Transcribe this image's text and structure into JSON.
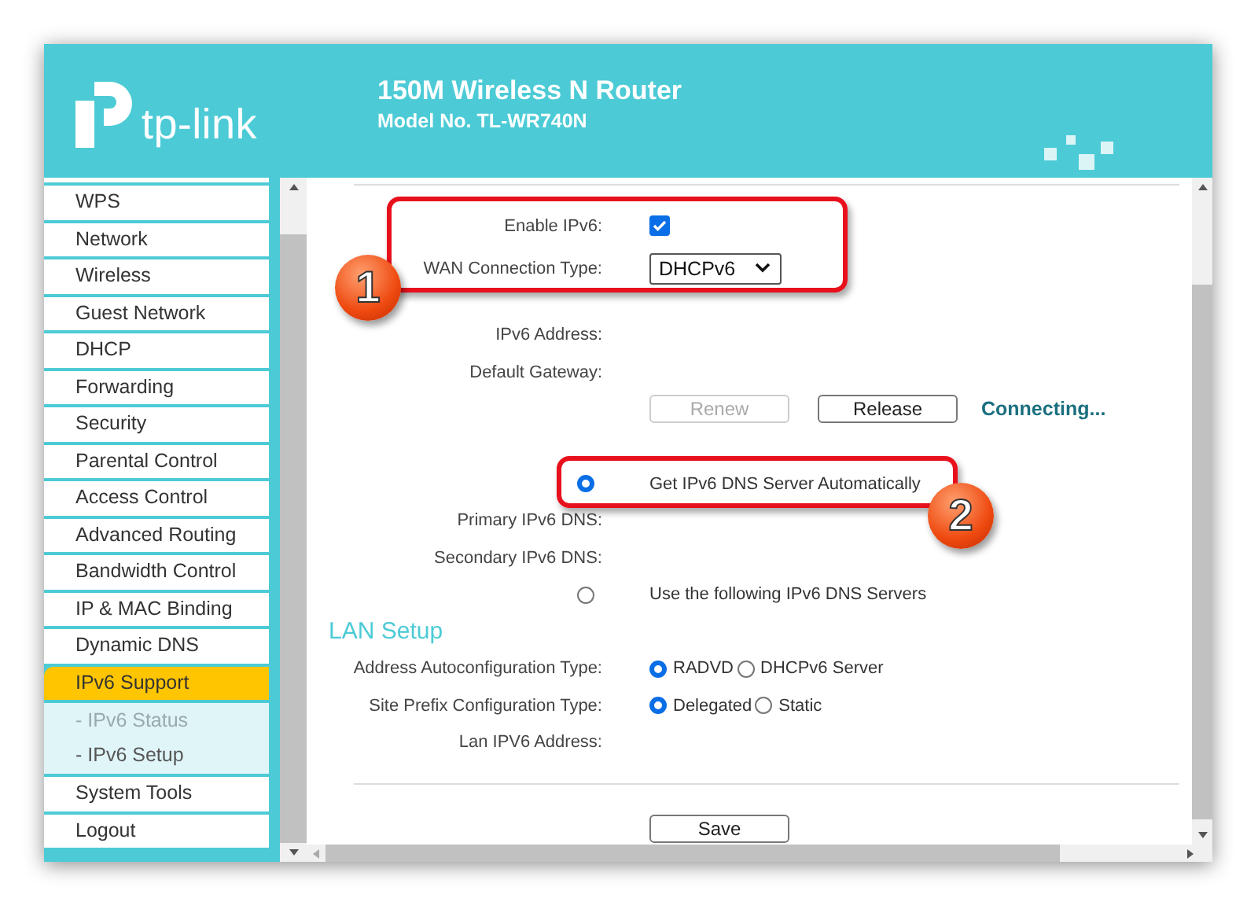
{
  "header": {
    "logo": "tp-link",
    "title": "150M Wireless N Router",
    "model": "Model No. TL-WR740N"
  },
  "sidebar": {
    "items": [
      {
        "label": "WPS",
        "selected": false
      },
      {
        "label": "Network",
        "selected": false
      },
      {
        "label": "Wireless",
        "selected": false
      },
      {
        "label": "Guest Network",
        "selected": false
      },
      {
        "label": "DHCP",
        "selected": false
      },
      {
        "label": "Forwarding",
        "selected": false
      },
      {
        "label": "Security",
        "selected": false
      },
      {
        "label": "Parental Control",
        "selected": false
      },
      {
        "label": "Access Control",
        "selected": false
      },
      {
        "label": "Advanced Routing",
        "selected": false
      },
      {
        "label": "Bandwidth Control",
        "selected": false
      },
      {
        "label": "IP & MAC Binding",
        "selected": false
      },
      {
        "label": "Dynamic DNS",
        "selected": false
      },
      {
        "label": "IPv6 Support",
        "selected": true,
        "children": [
          {
            "label": "- IPv6 Status",
            "selected": false
          },
          {
            "label": "- IPv6 Setup",
            "selected": true
          }
        ]
      },
      {
        "label": "System Tools",
        "selected": false
      },
      {
        "label": "Logout",
        "selected": false
      }
    ]
  },
  "form": {
    "rows": [
      {
        "kind": "checkbox",
        "label": "Enable IPv6:",
        "checked": true
      },
      {
        "kind": "select",
        "label": "WAN Connection Type:",
        "value": "DHCPv6"
      },
      {
        "kind": "info",
        "label": "IPv6 Address:"
      },
      {
        "kind": "info",
        "label": "Default Gateway:"
      },
      {
        "kind": "buttons",
        "buttons": [
          {
            "label": "Renew",
            "disabled": true
          },
          {
            "label": "Release",
            "disabled": false
          }
        ],
        "status": "Connecting..."
      },
      {
        "kind": "radio",
        "text": "Get IPv6 DNS Server Automatically",
        "selected": true
      },
      {
        "kind": "info",
        "label": "Primary IPv6 DNS:"
      },
      {
        "kind": "info",
        "label": "Secondary IPv6 DNS:"
      },
      {
        "kind": "radio",
        "text": "Use the following IPv6 DNS Servers",
        "selected": false
      },
      {
        "kind": "heading",
        "text": "LAN Setup"
      },
      {
        "kind": "radio-group",
        "label": "Address Autoconfiguration Type:",
        "options": [
          {
            "text": "RADVD",
            "selected": true
          },
          {
            "text": "DHCPv6 Server",
            "selected": false
          }
        ]
      },
      {
        "kind": "radio-group",
        "label": "Site Prefix Configuration Type:",
        "options": [
          {
            "text": "Delegated",
            "selected": true
          },
          {
            "text": "Static",
            "selected": false
          }
        ]
      },
      {
        "kind": "info",
        "label": "Lan IPV6 Address:"
      }
    ],
    "save": "Save"
  },
  "callouts": [
    {
      "number": "1"
    },
    {
      "number": "2"
    }
  ]
}
